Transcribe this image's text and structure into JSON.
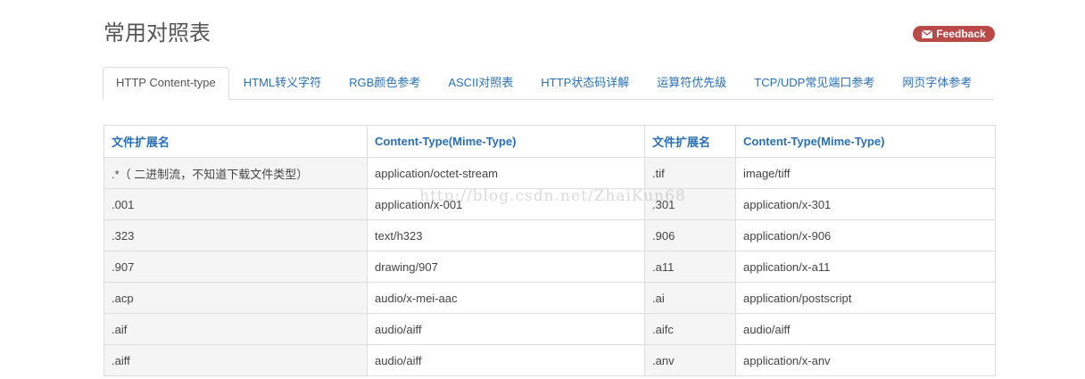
{
  "page": {
    "title": "常用对照表"
  },
  "feedback": {
    "label": "Feedback"
  },
  "tabs": [
    {
      "label": "HTTP Content-type",
      "active": true
    },
    {
      "label": "HTML转义字符"
    },
    {
      "label": "RGB颜色参考"
    },
    {
      "label": "ASCII对照表"
    },
    {
      "label": "HTTP状态码详解"
    },
    {
      "label": "运算符优先级"
    },
    {
      "label": "TCP/UDP常见端口参考"
    },
    {
      "label": "网页字体参考"
    }
  ],
  "table": {
    "headers": [
      "文件扩展名",
      "Content-Type(Mime-Type)",
      "文件扩展名",
      "Content-Type(Mime-Type)"
    ],
    "rows": [
      [
        ".*（ 二进制流，不知道下载文件类型）",
        "application/octet-stream",
        ".tif",
        "image/tiff"
      ],
      [
        ".001",
        "application/x-001",
        ".301",
        "application/x-301"
      ],
      [
        ".323",
        "text/h323",
        ".906",
        "application/x-906"
      ],
      [
        ".907",
        "drawing/907",
        ".a11",
        "application/x-a11"
      ],
      [
        ".acp",
        "audio/x-mei-aac",
        ".ai",
        "application/postscript"
      ],
      [
        ".aif",
        "audio/aiff",
        ".aifc",
        "audio/aiff"
      ],
      [
        ".aiff",
        "audio/aiff",
        ".anv",
        "application/x-anv"
      ]
    ]
  },
  "watermark": "http://blog.csdn.net/ZhaiKun68",
  "colors": {
    "link": "#2a6fb5",
    "feedback_bg": "#b94a48",
    "border": "#dddddd",
    "ext_bg": "#f5f5f5"
  },
  "icons": {
    "feedback": "envelope-icon"
  }
}
